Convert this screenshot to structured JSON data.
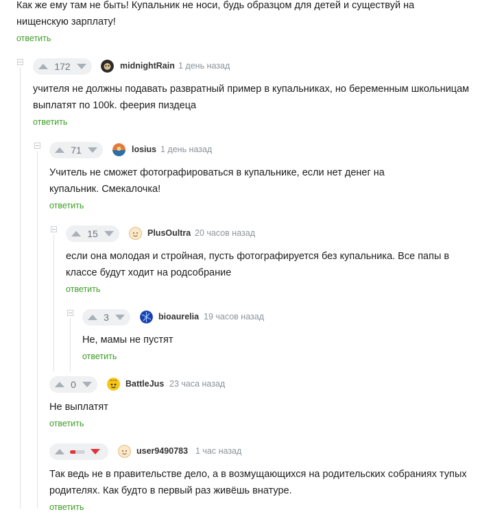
{
  "reply_label": "ответить",
  "top_comment": {
    "text_line1": "Как же ему там не быть! Купальник не носи, будь образцом для детей и существуй на",
    "text_line2": "нищенскую зарплату!"
  },
  "comments": [
    {
      "score": "172",
      "username": "midnightRain",
      "time": "1 день назад",
      "text_line1": "учителя не должны подавать развратный пример в купальниках, но беременным школьницам",
      "text_line2": "выплатят по 100k. феерия пиздеца"
    },
    {
      "score": "71",
      "username": "losius",
      "time": "1 день назад",
      "text_line1": "Учитель не сможет фотографироваться в купальнике, если нет денег на",
      "text_line2": "купальник. Смекалочка!"
    },
    {
      "score": "15",
      "username": "PlusOultra",
      "time": "20 часов назад",
      "text_line1": "если она молодая и стройная, пусть фотографируется без купальника. Все папы в",
      "text_line2": "классе будут ходит на родсобрание"
    },
    {
      "score": "3",
      "username": "bioaurelia",
      "time": "19 часов назад",
      "text_line1": "Не, мамы не пустят"
    },
    {
      "score": "0",
      "username": "BattleJus",
      "time": "23 часа назад",
      "text_line1": "Не выплатят"
    },
    {
      "rating_fraction": 0.35,
      "username": "user9490783",
      "time": "1 час назад",
      "text_line1": "Так ведь не в правительстве дело, а в возмущающихся на родительских собраниях тупых",
      "text_line2": "родителях. Как будто в первый раз живёшь внатуре."
    }
  ],
  "icons": {
    "upvote": "upvote-icon",
    "downvote": "downvote-icon",
    "collapse": "collapse-thread-icon"
  },
  "colors": {
    "reply_link": "#3b9d24",
    "downvote_active": "#e2323a",
    "vote_pill": "#eef0f2"
  }
}
